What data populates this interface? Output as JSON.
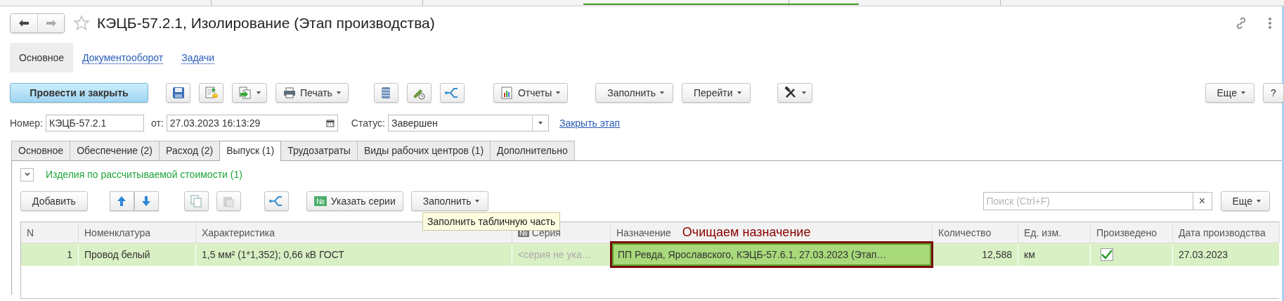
{
  "window": {
    "title": "КЭЦБ-57.2.1, Изолирование (Этап производства)"
  },
  "sections": [
    {
      "label": "Основное",
      "selected": true
    },
    {
      "label": "Документооборот",
      "selected": false
    },
    {
      "label": "Задачи",
      "selected": false
    }
  ],
  "toolbar": {
    "post_button": "Провести и закрыть",
    "print_button": "Печать",
    "reports_button": "Отчеты",
    "fill_button": "Заполнить",
    "goto_button": "Перейти",
    "more_button": "Еще",
    "help_button": "?"
  },
  "fields": {
    "number_label": "Номер:",
    "number_value": "КЭЦБ-57.2.1",
    "date_label": "от:",
    "date_value": "27.03.2023 16:13:29",
    "status_label": "Статус:",
    "status_value": "Завершен",
    "close_stage_link": "Закрыть этап"
  },
  "tabs": [
    {
      "label": "Основное",
      "selected": false
    },
    {
      "label": "Обеспечение (2)",
      "selected": false
    },
    {
      "label": "Расход (2)",
      "selected": false
    },
    {
      "label": "Выпуск (1)",
      "selected": true
    },
    {
      "label": "Трудозатраты",
      "selected": false
    },
    {
      "label": "Виды рабочих центров (1)",
      "selected": false
    },
    {
      "label": "Дополнительно",
      "selected": false
    }
  ],
  "group": {
    "title": "Изделия по рассчитываемой стоимости (1)",
    "expanded": true
  },
  "table_toolbar": {
    "add_button": "Добавить",
    "series_badge": "№",
    "series_button": "Указать серии",
    "fill_button": "Заполнить",
    "search_placeholder": "Поиск (Ctrl+F)",
    "clear_button": "×",
    "more_button": "Еще"
  },
  "tooltip": "Заполнить табличную часть",
  "annotation": "Очищаем назначение",
  "table": {
    "columns": [
      {
        "label": "N"
      },
      {
        "label": "Номенклатура"
      },
      {
        "label": "Характеристика"
      },
      {
        "label": "Серия",
        "badge": "№"
      },
      {
        "label": "Назначение"
      },
      {
        "label": "Количество"
      },
      {
        "label": "Ед. изм."
      },
      {
        "label": "Произведено"
      },
      {
        "label": "Дата производства"
      }
    ],
    "rows": [
      {
        "selected": true,
        "n": "1",
        "nomenclature": "Провод белый",
        "characteristic": "1,5 мм² (1*1,352); 0,66 кВ ГОСТ",
        "series_placeholder": "<серия не ука…",
        "destination": "ПП Ревда, Ярославского, КЭЦБ-57.6.1, 27.03.2023 (Этап…",
        "destination_highlighted": true,
        "quantity": "12,588",
        "unit": "км",
        "produced": true,
        "date": "27.03.2023"
      }
    ]
  }
}
